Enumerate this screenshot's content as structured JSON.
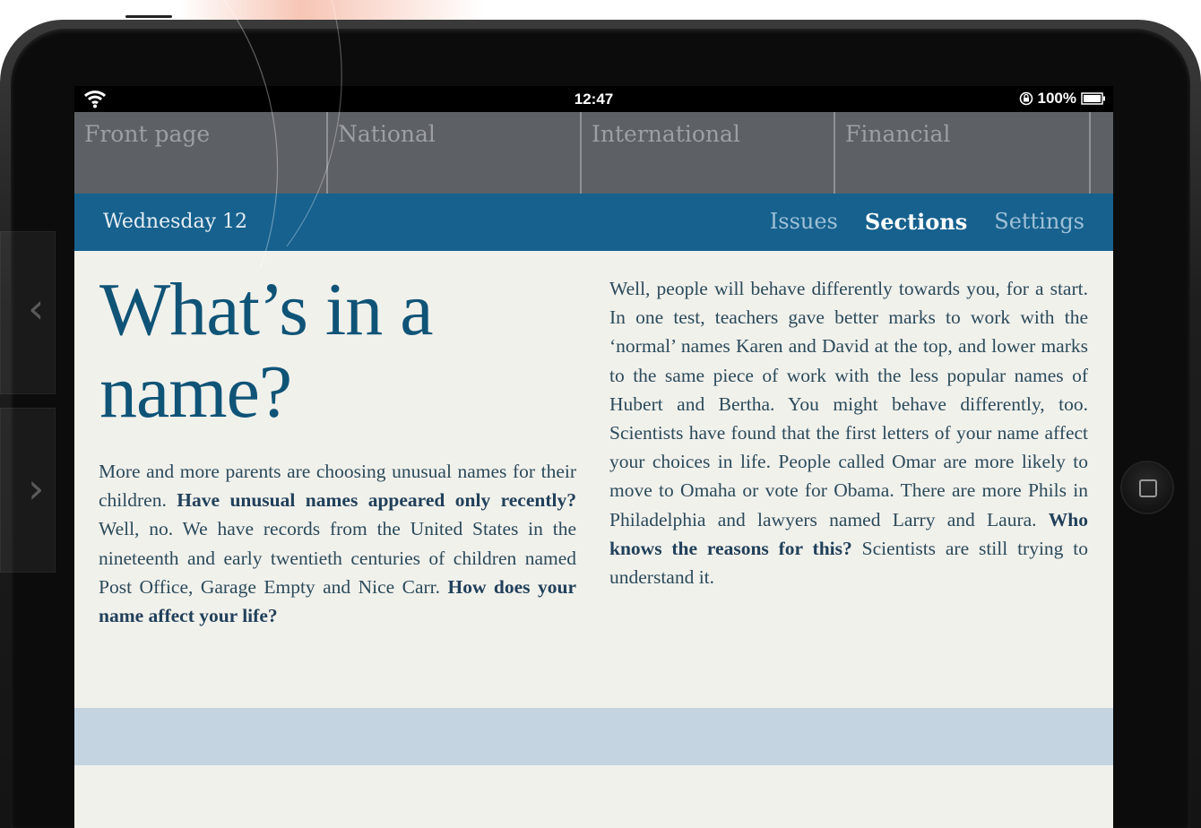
{
  "status": {
    "time": "12:47",
    "battery": "100%"
  },
  "sections": [
    {
      "label": "Front page"
    },
    {
      "label": "National"
    },
    {
      "label": "International"
    },
    {
      "label": "Financial"
    }
  ],
  "nav": {
    "date": "Wednesday 12",
    "issues": "Issues",
    "sections": "Sections",
    "settings": "Settings"
  },
  "article": {
    "headline": "What’s in a name?",
    "left": [
      {
        "t": "More and more parents are choosing unusual names for their children. ",
        "b": false
      },
      {
        "t": "Have unusual names appeared only recently?",
        "b": true
      },
      {
        "t": " Well, no. We have records from the United States in the nineteenth and early twentieth centuries of children named Post Office, Garage Empty and Nice Carr. ",
        "b": false
      },
      {
        "t": "How does your name affect your life?",
        "b": true
      }
    ],
    "right": [
      {
        "t": "Well, people will behave differently towards you, for a start. In one test, teachers gave better marks to work with the ‘normal’ names Karen and David at the top, and lower marks to the same piece of work with the less popular names of Hubert and Bertha. You might behave differently, too. Scientists have found that the first letters of your name affect your choices in life. People called Omar are more likely to move to Omaha or vote for Obama. There are more Phils in Philadelphia and lawyers named Larry and Laura. ",
        "b": false
      },
      {
        "t": "Who knows the reasons for this?",
        "b": true
      },
      {
        "t": " Scientists are still trying to understand it.",
        "b": false
      }
    ]
  },
  "icons": {
    "wifi": "wifi-icon",
    "rotation_lock": "rotation-lock-icon",
    "battery": "battery-icon",
    "home": "home-button-icon"
  },
  "colors": {
    "nav_bar": "#16618e",
    "headline": "#0f5477",
    "band": "#c4d5e1",
    "page": "#f1f1ec"
  }
}
